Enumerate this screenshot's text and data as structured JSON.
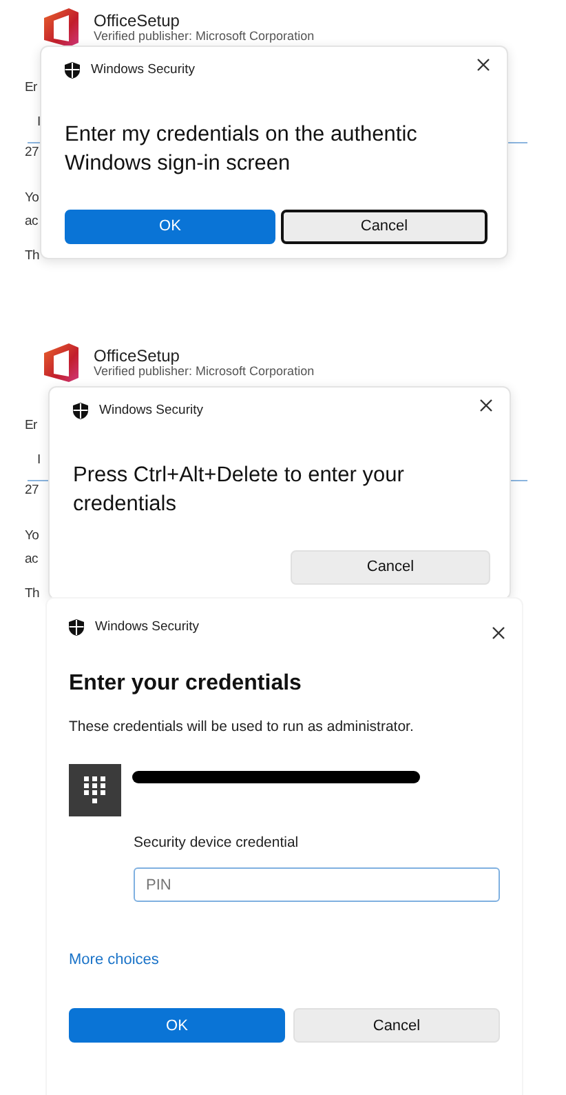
{
  "panels": [
    {
      "kind": "prompt",
      "app": {
        "name": "OfficeSetup",
        "publisher": "Verified publisher: Microsoft Corporation"
      },
      "background_fragments": [
        "Er",
        "I",
        "27",
        "Yo",
        "ac",
        "Th"
      ],
      "dialog": {
        "title": "Windows Security",
        "message": "Enter my credentials on the authentic Windows sign-in screen",
        "buttons": [
          {
            "label": "OK",
            "kind": "primary",
            "focused": false
          },
          {
            "label": "Cancel",
            "kind": "secondary",
            "focused": true
          }
        ]
      }
    },
    {
      "kind": "prompt",
      "app": {
        "name": "OfficeSetup",
        "publisher": "Verified publisher: Microsoft Corporation"
      },
      "background_fragments": [
        "Er",
        "I",
        "27",
        "Yo",
        "ac",
        "Th"
      ],
      "dialog": {
        "title": "Windows Security",
        "message": "Press Ctrl+Alt+Delete to enter your credentials",
        "buttons": [
          {
            "label": "Cancel",
            "kind": "secondary",
            "focused": false
          }
        ]
      }
    },
    {
      "kind": "credentials",
      "dialog": {
        "title": "Windows Security",
        "heading": "Enter your credentials",
        "description": "These credentials will be used to run as administrator.",
        "credential_label": "Security device credential",
        "pin": {
          "placeholder": "PIN"
        },
        "link": "More choices",
        "buttons": [
          {
            "label": "OK",
            "kind": "primary",
            "focused": false
          },
          {
            "label": "Cancel",
            "kind": "secondary",
            "focused": false
          }
        ]
      }
    }
  ]
}
